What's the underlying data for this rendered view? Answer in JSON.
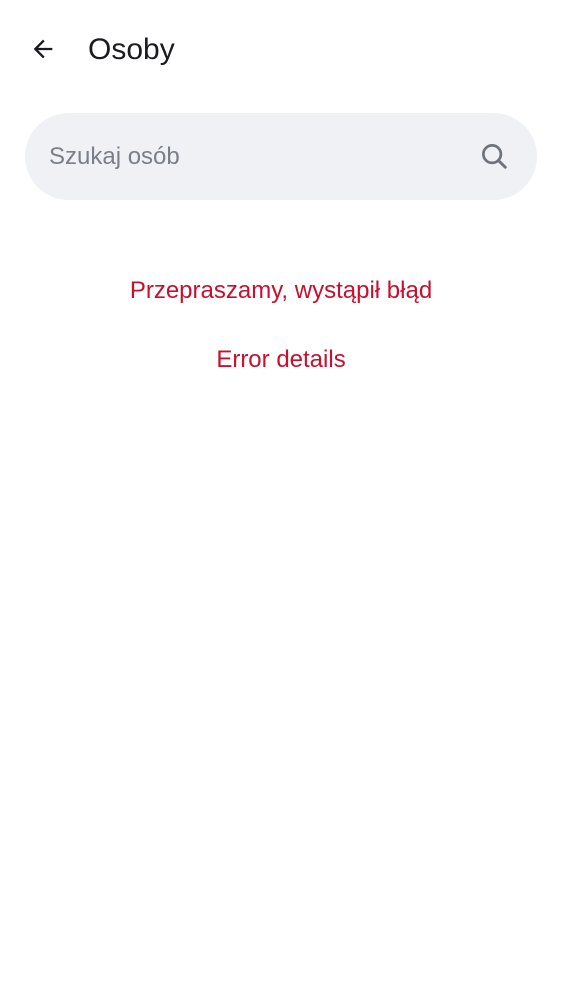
{
  "header": {
    "back_icon": "arrow-left-icon",
    "title": "Osoby"
  },
  "search": {
    "placeholder": "Szukaj osób",
    "value": "",
    "icon": "search-icon"
  },
  "error": {
    "message": "Przepraszamy, wystąpił błąd",
    "details_link": "Error details",
    "color": "#c8102e"
  },
  "colors": {
    "search_background": "#eff1f5",
    "title_text": "#1b1b1f",
    "placeholder_text": "#7a7f88"
  }
}
